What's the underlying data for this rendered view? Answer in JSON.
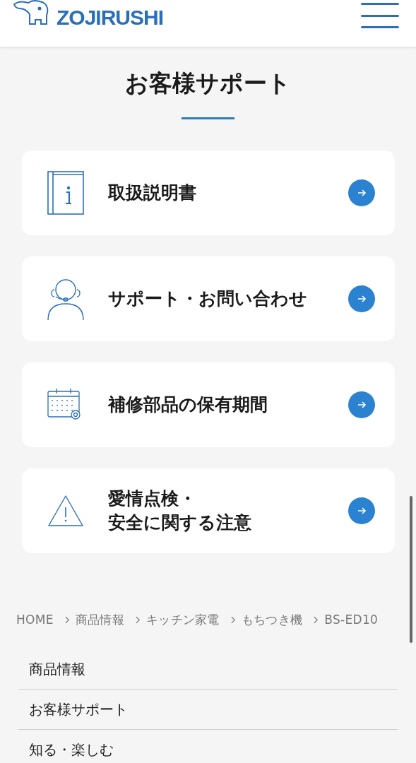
{
  "header": {
    "logo": "ZOJIRUSHI"
  },
  "page_title": "お客様サポート",
  "cards": [
    {
      "kind": "book",
      "lines": [
        "取扱説明書"
      ]
    },
    {
      "kind": "support",
      "lines": [
        "サポート・お問い合わせ"
      ]
    },
    {
      "kind": "calendar",
      "lines": [
        "補修部品の保有期間"
      ]
    },
    {
      "kind": "warning",
      "lines": [
        "愛情点検・",
        "安全に関する注意"
      ]
    }
  ],
  "breadcrumb": [
    "HOME",
    "商品情報",
    "キッチン家電",
    "もちつき機",
    "BS-ED10"
  ],
  "footer_nav": [
    "商品情報",
    "お客様サポート",
    "知る・楽しむ"
  ]
}
